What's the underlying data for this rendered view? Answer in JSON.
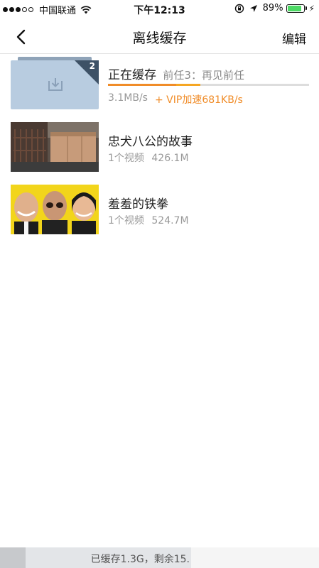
{
  "status_bar": {
    "carrier": "中国联通",
    "time": "下午12:13",
    "battery": "89%",
    "battery_level": 0.89,
    "signal_bars_filled": 3,
    "signal_bars_total": 5
  },
  "nav": {
    "title": "离线缓存",
    "edit_label": "编辑"
  },
  "downloading": {
    "title": "正在缓存",
    "subtitle": "前任3：再见前任",
    "badge_count": "2",
    "speed": "3.1MB/s",
    "vip_speed": "+ VIP加速681KB/s",
    "progress": 0.34,
    "vip_progress_start": 0.34,
    "vip_progress_end": 0.46
  },
  "items": [
    {
      "title": "忠犬八公的故事",
      "count": "1个视频",
      "size": "426.1M"
    },
    {
      "title": "羞羞的铁拳",
      "count": "1个视频",
      "size": "524.7M"
    }
  ],
  "storage": {
    "text": "已缓存1.3G，剩余15.",
    "used_fraction": 0.08,
    "free_fraction": 0.52
  },
  "colors": {
    "accent": "#f08c28",
    "battery_green": "#4cd964"
  }
}
